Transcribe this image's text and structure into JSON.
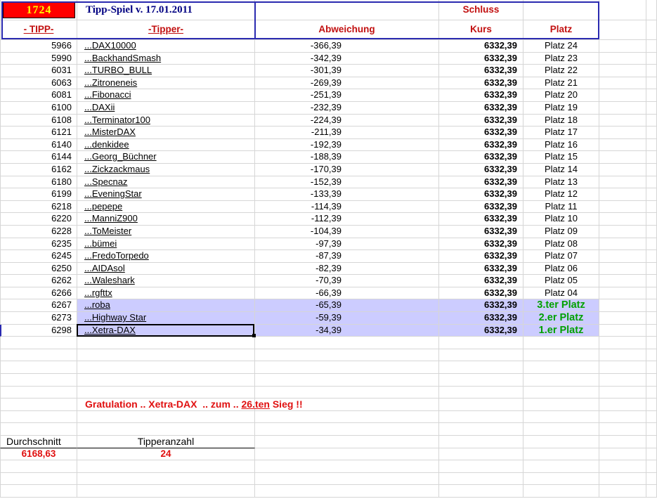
{
  "header": {
    "tipp_number": "1724",
    "title": "Tipp-Spiel v. 17.01.2011",
    "schluss": "Schluss",
    "columns": {
      "tipp": "- TIPP-",
      "tipper": "-Tipper-",
      "abweichung": "Abweichung",
      "kurs": "Kurs",
      "platz": "Platz"
    }
  },
  "rows": [
    {
      "tipp": "5966",
      "tipper": "...DAX10000",
      "abw": "-366,39",
      "kurs": "6332,39",
      "platz": "Platz 24",
      "winner": false,
      "selected": false
    },
    {
      "tipp": "5990",
      "tipper": "...BackhandSmash",
      "abw": "-342,39",
      "kurs": "6332,39",
      "platz": "Platz 23",
      "winner": false,
      "selected": false
    },
    {
      "tipp": "6031",
      "tipper": "...TURBO_BULL",
      "abw": "-301,39",
      "kurs": "6332,39",
      "platz": "Platz 22",
      "winner": false,
      "selected": false
    },
    {
      "tipp": "6063",
      "tipper": "...Zitroneneis",
      "abw": "-269,39",
      "kurs": "6332,39",
      "platz": "Platz 21",
      "winner": false,
      "selected": false
    },
    {
      "tipp": "6081",
      "tipper": "...Fibonacci",
      "abw": "-251,39",
      "kurs": "6332,39",
      "platz": "Platz 20",
      "winner": false,
      "selected": false
    },
    {
      "tipp": "6100",
      "tipper": "...DAXii",
      "abw": "-232,39",
      "kurs": "6332,39",
      "platz": "Platz 19",
      "winner": false,
      "selected": false
    },
    {
      "tipp": "6108",
      "tipper": "...Terminator100",
      "abw": "-224,39",
      "kurs": "6332,39",
      "platz": "Platz 18",
      "winner": false,
      "selected": false
    },
    {
      "tipp": "6121",
      "tipper": "...MisterDAX",
      "abw": "-211,39",
      "kurs": "6332,39",
      "platz": "Platz 17",
      "winner": false,
      "selected": false
    },
    {
      "tipp": "6140",
      "tipper": "...denkidee",
      "abw": "-192,39",
      "kurs": "6332,39",
      "platz": "Platz 16",
      "winner": false,
      "selected": false
    },
    {
      "tipp": "6144",
      "tipper": "...Georg_Büchner",
      "abw": "-188,39",
      "kurs": "6332,39",
      "platz": "Platz 15",
      "winner": false,
      "selected": false
    },
    {
      "tipp": "6162",
      "tipper": "...Zickzackmaus",
      "abw": "-170,39",
      "kurs": "6332,39",
      "platz": "Platz 14",
      "winner": false,
      "selected": false
    },
    {
      "tipp": "6180",
      "tipper": "...Specnaz",
      "abw": "-152,39",
      "kurs": "6332,39",
      "platz": "Platz 13",
      "winner": false,
      "selected": false
    },
    {
      "tipp": "6199",
      "tipper": "...EveningStar",
      "abw": "-133,39",
      "kurs": "6332,39",
      "platz": "Platz 12",
      "winner": false,
      "selected": false
    },
    {
      "tipp": "6218",
      "tipper": "...pepepe",
      "abw": "-114,39",
      "kurs": "6332,39",
      "platz": "Platz 11",
      "winner": false,
      "selected": false
    },
    {
      "tipp": "6220",
      "tipper": "...ManniZ900",
      "abw": "-112,39",
      "kurs": "6332,39",
      "platz": "Platz 10",
      "winner": false,
      "selected": false
    },
    {
      "tipp": "6228",
      "tipper": "...ToMeister",
      "abw": "-104,39",
      "kurs": "6332,39",
      "platz": "Platz 09",
      "winner": false,
      "selected": false
    },
    {
      "tipp": "6235",
      "tipper": "...bümei",
      "abw": "-97,39",
      "kurs": "6332,39",
      "platz": "Platz 08",
      "winner": false,
      "selected": false
    },
    {
      "tipp": "6245",
      "tipper": "...FredoTorpedo",
      "abw": "-87,39",
      "kurs": "6332,39",
      "platz": "Platz 07",
      "winner": false,
      "selected": false
    },
    {
      "tipp": "6250",
      "tipper": "...AIDAsol",
      "abw": "-82,39",
      "kurs": "6332,39",
      "platz": "Platz 06",
      "winner": false,
      "selected": false
    },
    {
      "tipp": "6262",
      "tipper": "...Waleshark",
      "abw": "-70,39",
      "kurs": "6332,39",
      "platz": "Platz 05",
      "winner": false,
      "selected": false
    },
    {
      "tipp": "6266",
      "tipper": "...rgfttx",
      "abw": "-66,39",
      "kurs": "6332,39",
      "platz": "Platz 04",
      "winner": false,
      "selected": false
    },
    {
      "tipp": "6267",
      "tipper": "...roba",
      "abw": "-65,39",
      "kurs": "6332,39",
      "platz": "3.ter Platz",
      "winner": true,
      "selected": false
    },
    {
      "tipp": "6273",
      "tipper": "...Highway Star",
      "abw": "-59,39",
      "kurs": "6332,39",
      "platz": "2.er Platz",
      "winner": true,
      "selected": false
    },
    {
      "tipp": "6298",
      "tipper": "...Xetra-DAX",
      "abw": "-34,39",
      "kurs": "6332,39",
      "platz": "1.er Platz",
      "winner": true,
      "selected": true
    }
  ],
  "footer": {
    "congrats_part1": "Gratulation .. Xetra-DAX  .. zum .. ",
    "congrats_part2": "26.ten",
    "congrats_part3": " Sieg !!",
    "durchschnitt_label": "Durchschnitt",
    "tipperanzahl_label": "Tipperanzahl",
    "durchschnitt_value": "6168,63",
    "tipperanzahl_value": "24"
  },
  "colors": {
    "header_red": "#c21010",
    "bright_red": "#e01010",
    "title_navy": "#000082",
    "winner_green": "#00a000",
    "highlight_lavender": "#ccccff",
    "selection_blue": "#2a2ab0",
    "tipp_cell_background": "#ff0000",
    "tipp_cell_text": "#ffff00",
    "gridline": "#d6d6d6"
  }
}
